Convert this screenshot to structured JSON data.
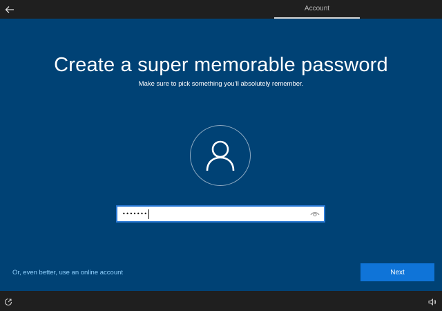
{
  "topbar": {
    "back_icon": "back-arrow-icon",
    "step_label": "Account"
  },
  "main": {
    "title": "Create a super memorable password",
    "subtitle": "Make sure to pick something you’ll absolutely remember.",
    "avatar_icon": "user-icon",
    "password_field": {
      "value_masked": "•••••••",
      "reveal_icon": "eye-icon"
    },
    "online_account_link": "Or, even better, use an online account",
    "next_label": "Next"
  },
  "bottombar": {
    "accessibility_icon": "ease-of-access-icon",
    "volume_icon": "volume-icon"
  },
  "colors": {
    "background": "#004275",
    "bar": "#1f1f1f",
    "accent": "#0f74d8",
    "link": "#8fd1ff",
    "field_border": "#2b7ad6"
  }
}
